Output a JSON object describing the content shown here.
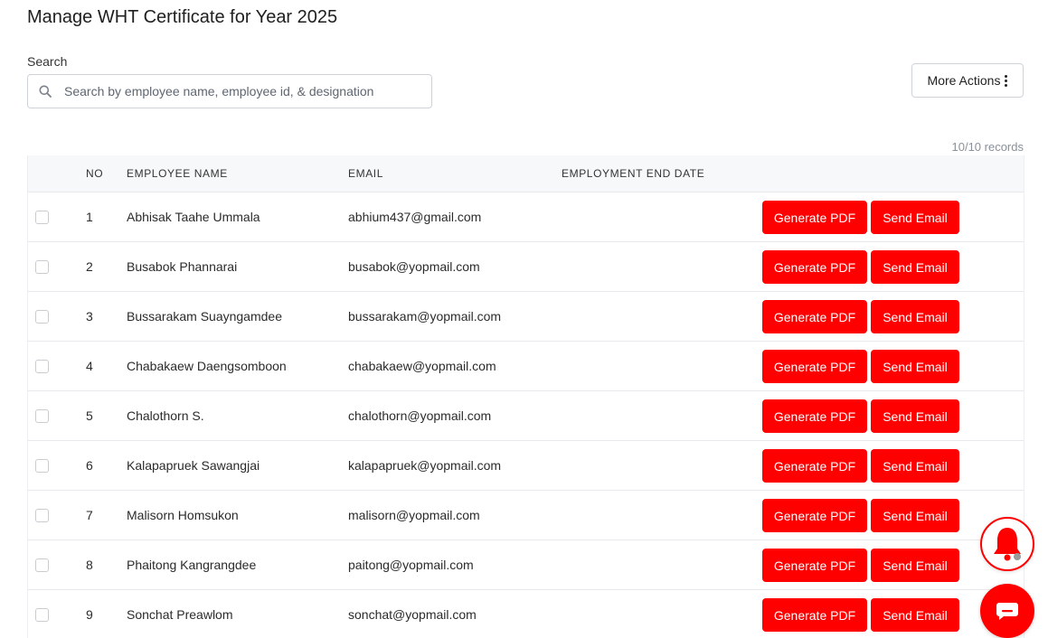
{
  "page": {
    "title": "Manage WHT Certificate for Year 2025"
  },
  "search": {
    "label": "Search",
    "placeholder": "Search by employee name, employee id, & designation",
    "value": ""
  },
  "actions": {
    "more_actions_label": "More Actions"
  },
  "records": {
    "count_label": "10/10 records"
  },
  "table": {
    "headers": {
      "no": "NO",
      "name": "EMPLOYEE NAME",
      "email": "EMAIL",
      "end_date": "EMPLOYMENT END DATE"
    },
    "rows": [
      {
        "no": "1",
        "name": "Abhisak Taahe Ummala",
        "email": "abhium437@gmail.com",
        "end_date": ""
      },
      {
        "no": "2",
        "name": "Busabok Phannarai",
        "email": "busabok@yopmail.com",
        "end_date": ""
      },
      {
        "no": "3",
        "name": "Bussarakam Suayngamdee",
        "email": "bussarakam@yopmail.com",
        "end_date": ""
      },
      {
        "no": "4",
        "name": "Chabakaew Daengsomboon",
        "email": "chabakaew@yopmail.com",
        "end_date": ""
      },
      {
        "no": "5",
        "name": "Chalothorn S.",
        "email": "chalothorn@yopmail.com",
        "end_date": ""
      },
      {
        "no": "6",
        "name": "Kalapapruek Sawangjai",
        "email": "kalapapruek@yopmail.com",
        "end_date": ""
      },
      {
        "no": "7",
        "name": "Malisorn Homsukon",
        "email": "malisorn@yopmail.com",
        "end_date": ""
      },
      {
        "no": "8",
        "name": "Phaitong Kangrangdee",
        "email": "paitong@yopmail.com",
        "end_date": ""
      },
      {
        "no": "9",
        "name": "Sonchat Preawlom",
        "email": "sonchat@yopmail.com",
        "end_date": ""
      }
    ],
    "row_actions": {
      "generate_pdf_label": "Generate PDF",
      "send_email_label": "Send Email"
    }
  },
  "icons": {
    "search": "search-icon",
    "more": "kebab-vertical-icon",
    "bell": "bell-icon",
    "chat": "chat-icon"
  },
  "colors": {
    "accent": "#ff0000",
    "header_bg": "#f7f8fa",
    "muted_text": "#8a9099"
  }
}
